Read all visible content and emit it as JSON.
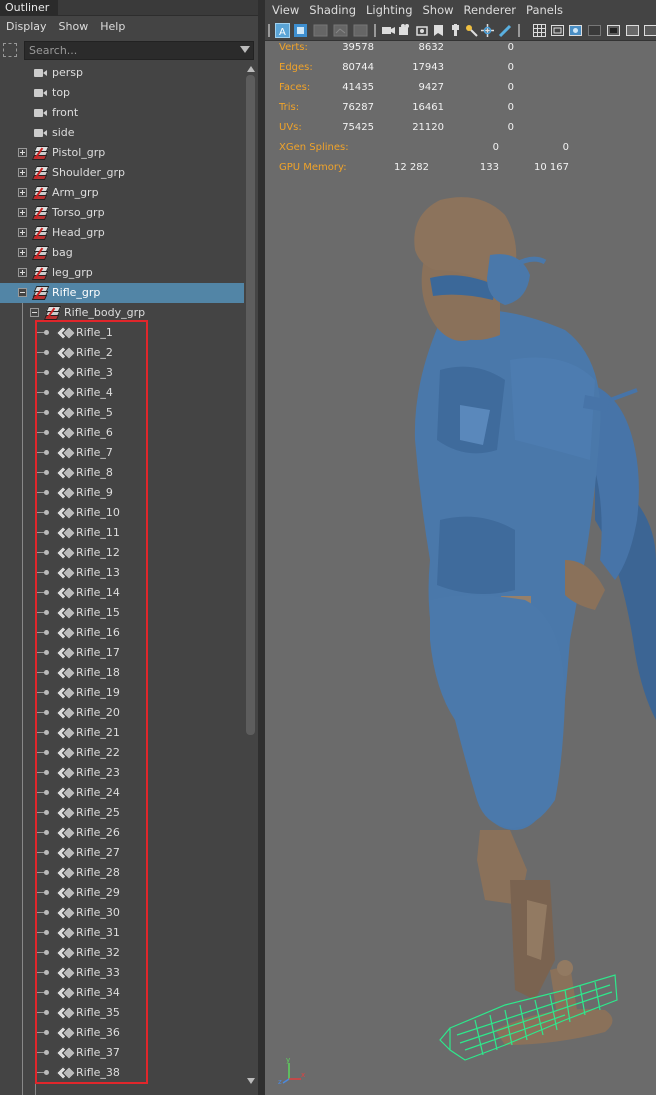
{
  "outliner": {
    "tab_title": "Outliner",
    "menu": [
      "Display",
      "Show",
      "Help"
    ],
    "search_placeholder": "Search...",
    "cameras": [
      "persp",
      "top",
      "front",
      "side"
    ],
    "groups": [
      "Pistol_grp",
      "Shoulder_grp",
      "Arm_grp",
      "Torso_grp",
      "Head_grp",
      "bag",
      "leg_grp"
    ],
    "selected_group": "Rifle_grp",
    "sub_group": "Rifle_body_grp",
    "rifle_items": [
      "Rifle_1",
      "Rifle_2",
      "Rifle_3",
      "Rifle_4",
      "Rifle_5",
      "Rifle_6",
      "Rifle_7",
      "Rifle_8",
      "Rifle_9",
      "Rifle_10",
      "Rifle_11",
      "Rifle_12",
      "Rifle_13",
      "Rifle_14",
      "Rifle_15",
      "Rifle_16",
      "Rifle_17",
      "Rifle_18",
      "Rifle_19",
      "Rifle_20",
      "Rifle_21",
      "Rifle_22",
      "Rifle_23",
      "Rifle_24",
      "Rifle_25",
      "Rifle_26",
      "Rifle_27",
      "Rifle_28",
      "Rifle_29",
      "Rifle_30",
      "Rifle_31",
      "Rifle_32",
      "Rifle_33",
      "Rifle_34",
      "Rifle_35",
      "Rifle_36",
      "Rifle_37",
      "Rifle_38"
    ]
  },
  "viewport": {
    "menu": [
      "View",
      "Shading",
      "Lighting",
      "Show",
      "Renderer",
      "Panels"
    ],
    "hud": [
      {
        "label": "Verts:",
        "values": [
          "39578",
          "8632",
          "0"
        ]
      },
      {
        "label": "Edges:",
        "values": [
          "80744",
          "17943",
          "0"
        ]
      },
      {
        "label": "Faces:",
        "values": [
          "41435",
          "9427",
          "0"
        ]
      },
      {
        "label": "Tris:",
        "values": [
          "76287",
          "16461",
          "0"
        ]
      },
      {
        "label": "UVs:",
        "values": [
          "75425",
          "21120",
          "0"
        ]
      },
      {
        "label": "XGen Splines:",
        "values": [
          "",
          "0",
          "0"
        ]
      },
      {
        "label": "GPU Memory:",
        "values": [
          "12 282",
          "133",
          "10 167"
        ]
      }
    ],
    "axis_labels": {
      "x": "x",
      "y": "y",
      "z": "z"
    }
  },
  "colors": {
    "selection": "#5285a6",
    "hud_label": "#f0a32a",
    "highlight_box": "#e0262b",
    "model_blue": "#4a78aa",
    "model_brown": "#8a715a",
    "wireframe_green": "#2ee88c"
  }
}
